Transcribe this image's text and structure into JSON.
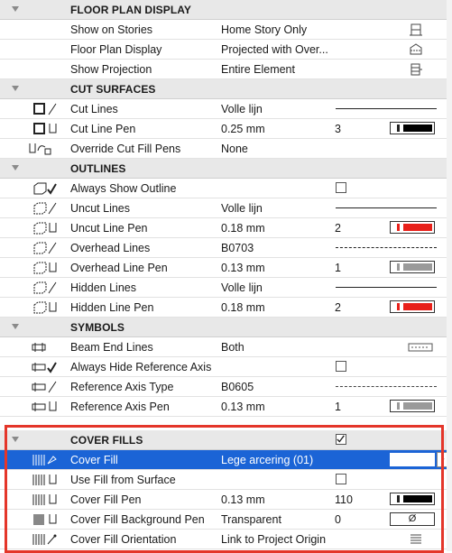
{
  "sections": [
    {
      "title": "FLOOR PLAN DISPLAY",
      "rows": [
        {
          "label": "Show on Stories",
          "value": "Home Story Only",
          "icon": "story-icon"
        },
        {
          "label": "Floor Plan Display",
          "value": "Projected with Over...",
          "icon": "projection-icon"
        },
        {
          "label": "Show Projection",
          "value": "Entire Element",
          "icon": "entire-element-icon"
        }
      ]
    },
    {
      "title": "CUT SURFACES",
      "rows": [
        {
          "label": "Cut Lines",
          "value": "Volle lijn",
          "icon": "cut-lines-icon"
        },
        {
          "label": "Cut Line Pen",
          "value": "0.25 mm",
          "pen": "3",
          "pen_color": "#000000",
          "icon": "cut-line-pen-icon"
        },
        {
          "label": "Override Cut Fill Pens",
          "value": "None",
          "icon": "override-fill-icon"
        }
      ]
    },
    {
      "title": "OUTLINES",
      "rows": [
        {
          "label": "Always Show Outline",
          "icon": "show-outline-icon"
        },
        {
          "label": "Uncut Lines",
          "value": "Volle lijn",
          "icon": "uncut-lines-icon"
        },
        {
          "label": "Uncut Line Pen",
          "value": "0.18 mm",
          "pen": "2",
          "pen_color": "#e8201a",
          "icon": "uncut-line-pen-icon"
        },
        {
          "label": "Overhead Lines",
          "value": "B0703",
          "icon": "overhead-lines-icon"
        },
        {
          "label": "Overhead Line Pen",
          "value": "0.13 mm",
          "pen": "1",
          "pen_color": "#9a9a9a",
          "icon": "overhead-line-pen-icon"
        },
        {
          "label": "Hidden Lines",
          "value": "Volle lijn",
          "icon": "hidden-lines-icon"
        },
        {
          "label": "Hidden Line Pen",
          "value": "0.18 mm",
          "pen": "2",
          "pen_color": "#e8201a",
          "icon": "hidden-line-pen-icon"
        }
      ]
    },
    {
      "title": "SYMBOLS",
      "rows": [
        {
          "label": "Beam End Lines",
          "value": "Both",
          "icon": "beam-end-icon"
        },
        {
          "label": "Always Hide Reference Axis",
          "icon": "hide-axis-icon"
        },
        {
          "label": "Reference Axis Type",
          "value": "B0605",
          "icon": "axis-type-icon"
        },
        {
          "label": "Reference Axis Pen",
          "value": "0.13 mm",
          "pen": "1",
          "pen_color": "#9a9a9a",
          "icon": "axis-pen-icon"
        }
      ]
    },
    {
      "title": "COVER FILLS",
      "rows": [
        {
          "label": "Cover Fill",
          "value": "Lege arcering (01)",
          "icon": "cover-fill-icon"
        },
        {
          "label": "Use Fill from Surface",
          "icon": "fill-from-surface-icon"
        },
        {
          "label": "Cover Fill Pen",
          "value": "0.13 mm",
          "pen": "110",
          "pen_color": "#000000",
          "icon": "cover-fill-pen-icon"
        },
        {
          "label": "Cover Fill Background Pen",
          "value": "Transparent",
          "pen": "0",
          "swatch_text": "Ø",
          "icon": "background-pen-icon"
        },
        {
          "label": "Cover Fill Orientation",
          "value": "Link to Project Origin",
          "icon": "orientation-icon"
        }
      ]
    }
  ],
  "expand_arrow": "›",
  "colors": {
    "selected": "#1b64d6",
    "highlight": "#e4362a",
    "header": "#e8e8e8"
  }
}
